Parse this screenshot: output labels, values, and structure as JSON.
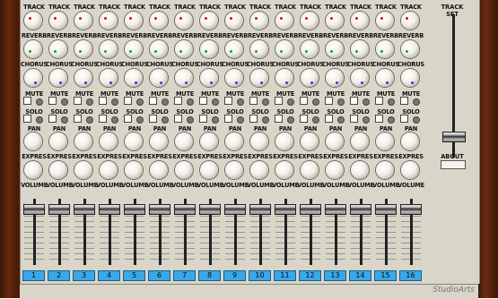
{
  "labels": {
    "track": "TRACK",
    "reverb": "REVERB",
    "chorus": "CHORUS",
    "mute": "MUTE",
    "solo": "SOLO",
    "pan": "PAN",
    "expression": "EXPRES",
    "volume": "VOLUME"
  },
  "channels": [
    "1",
    "2",
    "3",
    "4",
    "5",
    "6",
    "7",
    "8",
    "9",
    "10",
    "11",
    "12",
    "13",
    "14",
    "15",
    "16"
  ],
  "master": {
    "title": "TRACK SET",
    "value": "1",
    "about_label": "ABOUT"
  },
  "brand": "StudioArts",
  "colors": {
    "panel": "#d9d5c8",
    "channel_number_bg": "#39a8e8",
    "knob_indicator_track": "#c01616",
    "knob_indicator_reverb": "#1e9b3c",
    "knob_indicator_chorus": "#2c3fd0"
  }
}
